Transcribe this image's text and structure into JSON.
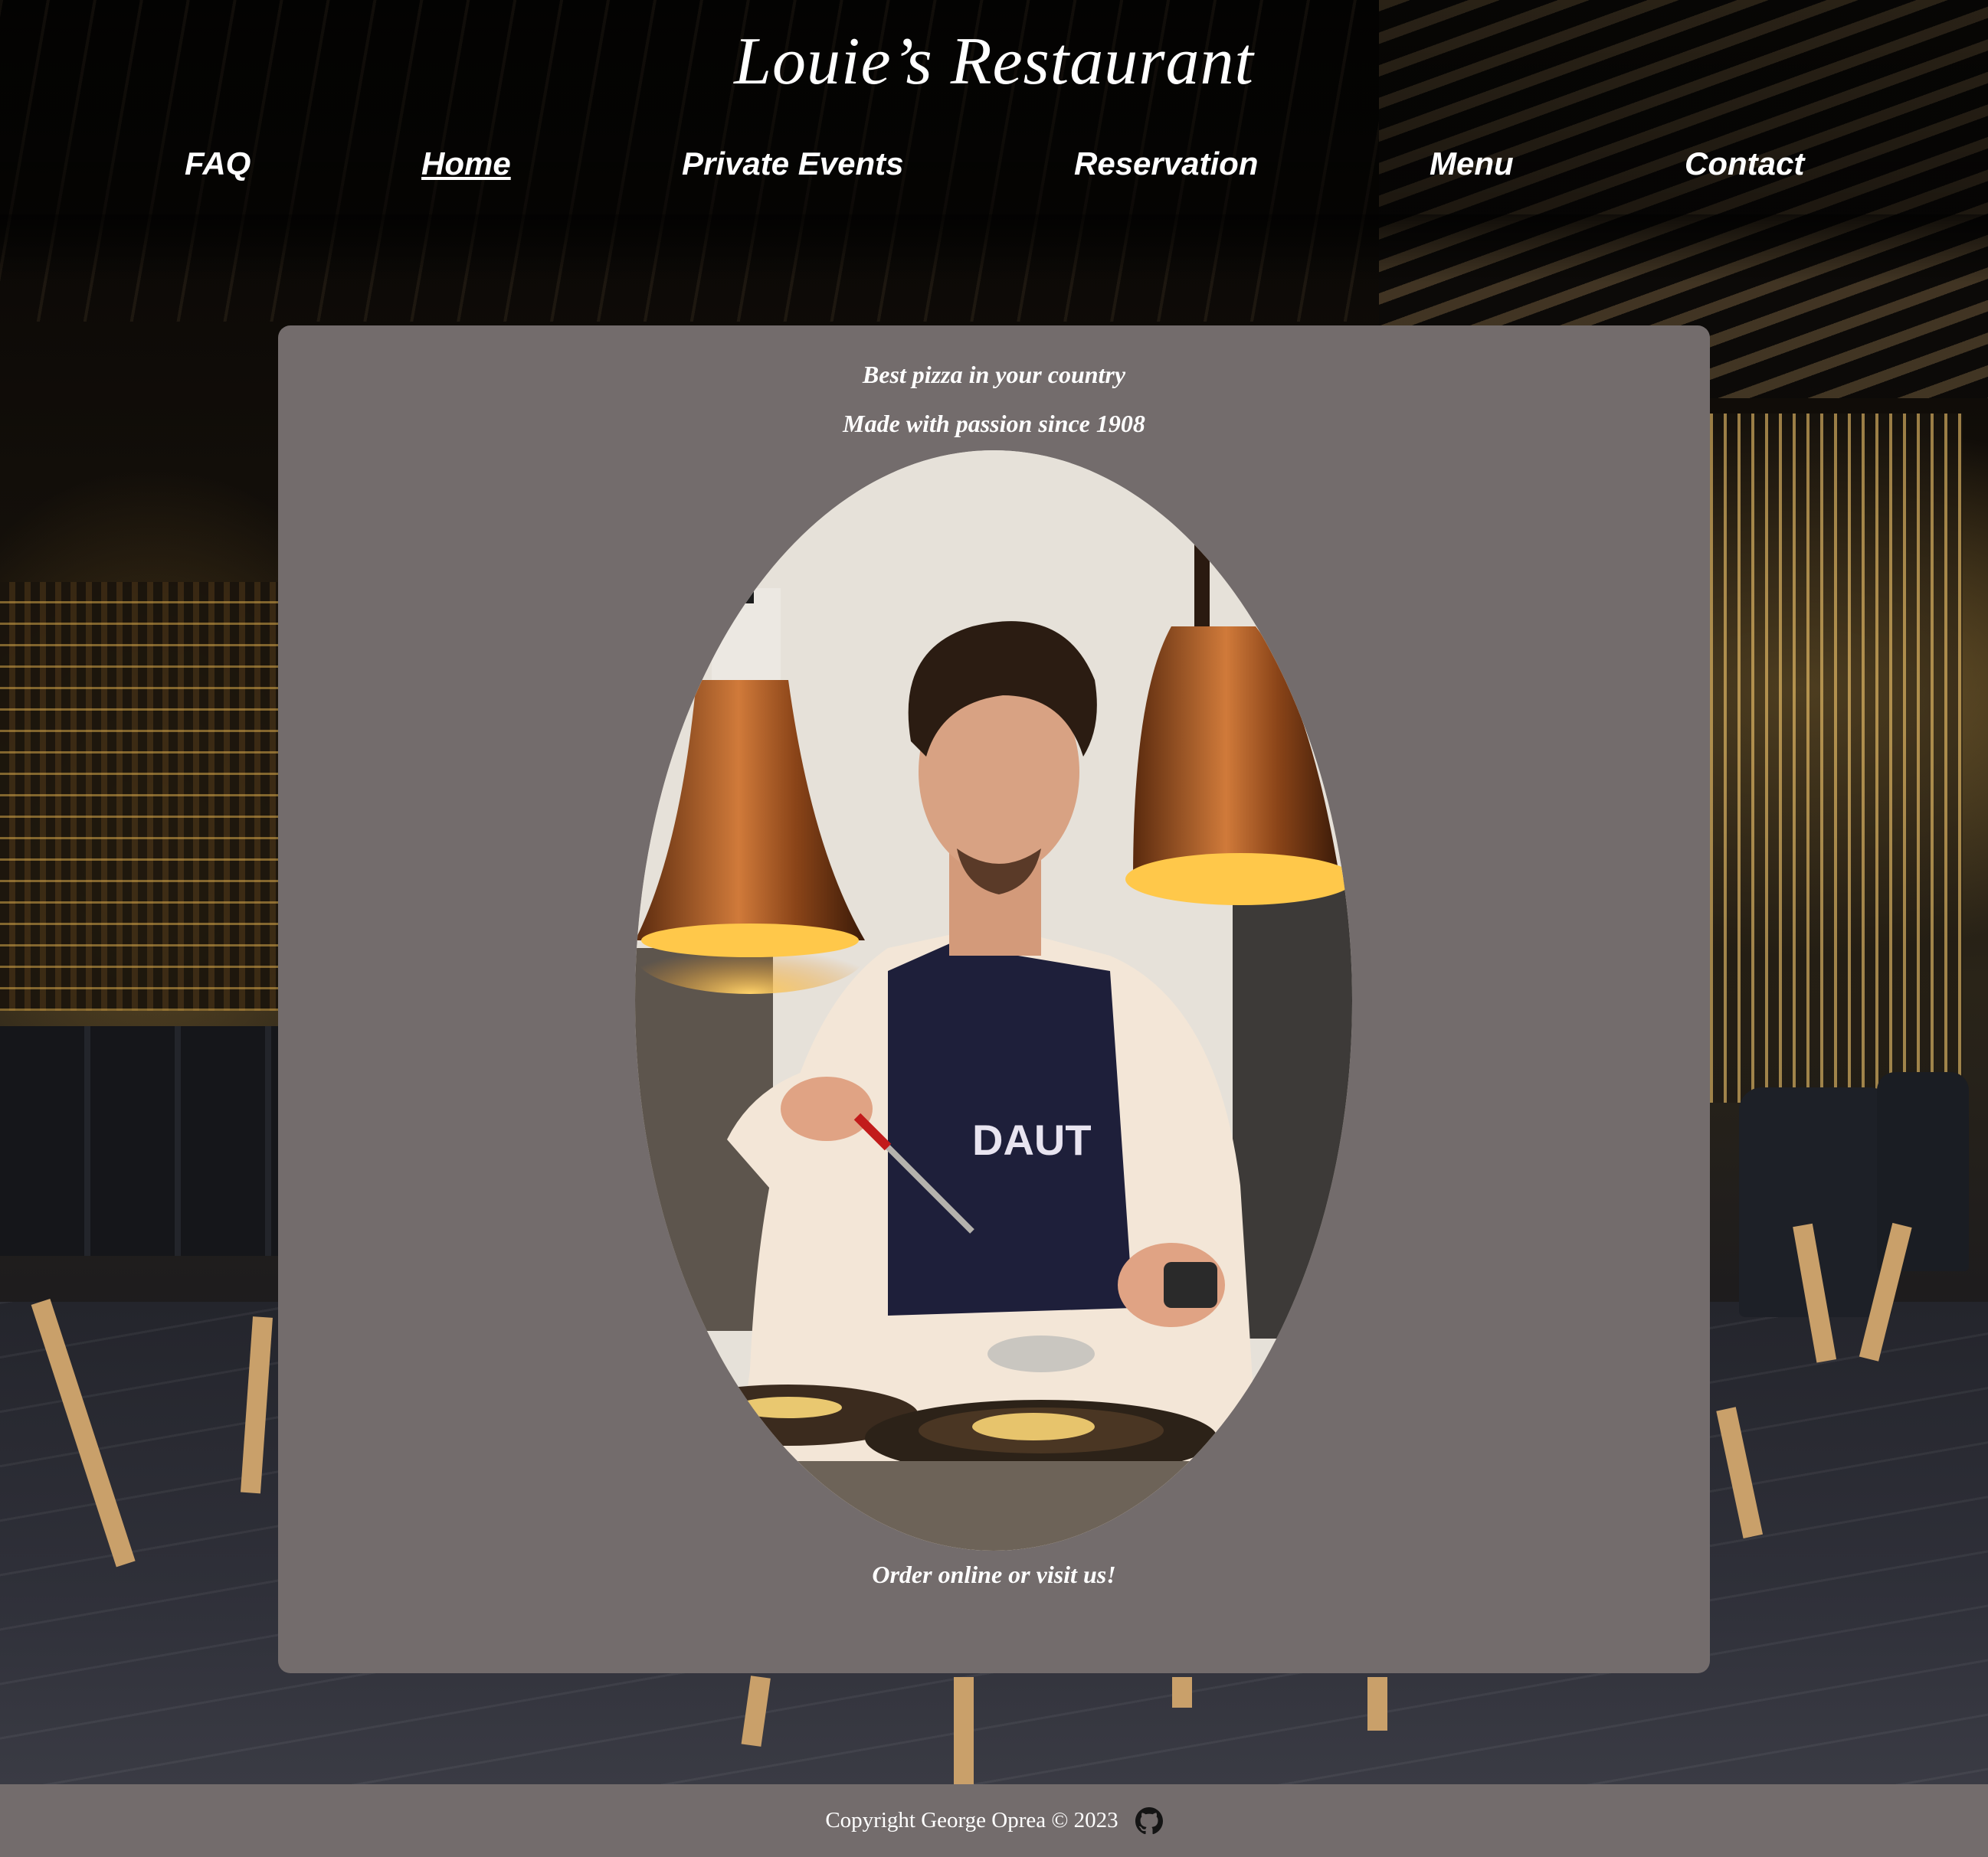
{
  "site": {
    "title": "Louie’s Restaurant"
  },
  "nav": {
    "items": [
      {
        "label": "FAQ"
      },
      {
        "label": "Home"
      },
      {
        "label": "Private Events"
      },
      {
        "label": "Reservation"
      },
      {
        "label": "Menu"
      },
      {
        "label": "Contact"
      }
    ],
    "active": "Home"
  },
  "main": {
    "tagline_1": "Best pizza in your country",
    "tagline_2": "Made with passion since 1908",
    "cta": "Order online or visit us!",
    "image": "chef-plating-photo",
    "apron_text": "DAUT"
  },
  "footer": {
    "copyright": "Copyright George Oprea © 2023",
    "icon": "github-icon"
  },
  "colors": {
    "panel": "#736c6c",
    "footer": "#736c6c",
    "text": "#ffffff"
  }
}
